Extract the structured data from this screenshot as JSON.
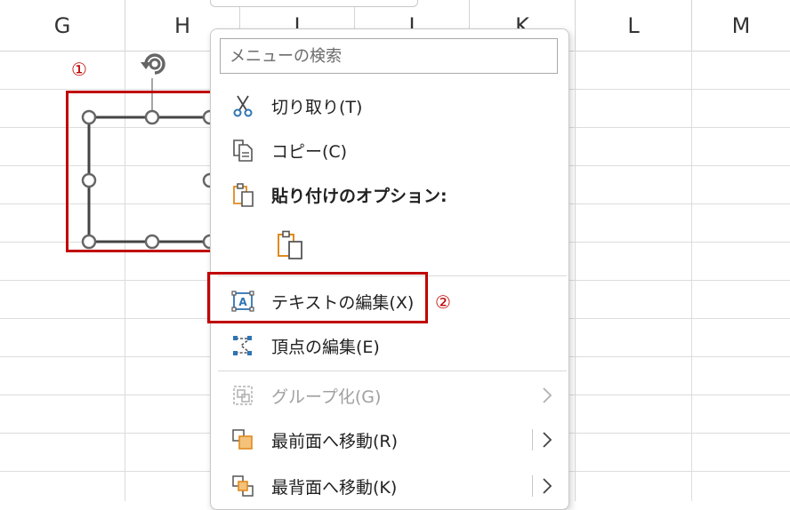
{
  "columns": [
    "G",
    "H",
    "I",
    "J",
    "K",
    "L",
    "M"
  ],
  "annotations": {
    "marker1": "①",
    "marker2": "②"
  },
  "menu": {
    "search_placeholder": "メニューの検索",
    "items": [
      {
        "label": "切り取り(T)",
        "icon": "scissors-icon"
      },
      {
        "label": "コピー(C)",
        "icon": "copy-icon"
      },
      {
        "label": "貼り付けのオプション:",
        "icon": "paste-options-icon"
      },
      {
        "label": "テキストの編集(X)",
        "icon": "edit-text-icon"
      },
      {
        "label": "頂点の編集(E)",
        "icon": "edit-points-icon"
      },
      {
        "label": "グループ化(G)",
        "icon": "group-icon",
        "disabled": true
      },
      {
        "label": "最前面へ移動(R)",
        "icon": "bring-to-front-icon"
      },
      {
        "label": "最背面へ移動(K)",
        "icon": "send-to-back-icon"
      }
    ]
  },
  "colors": {
    "accent_red": "#c00000",
    "icon_blue": "#2e75b6",
    "icon_orange": "#e08a1e"
  }
}
